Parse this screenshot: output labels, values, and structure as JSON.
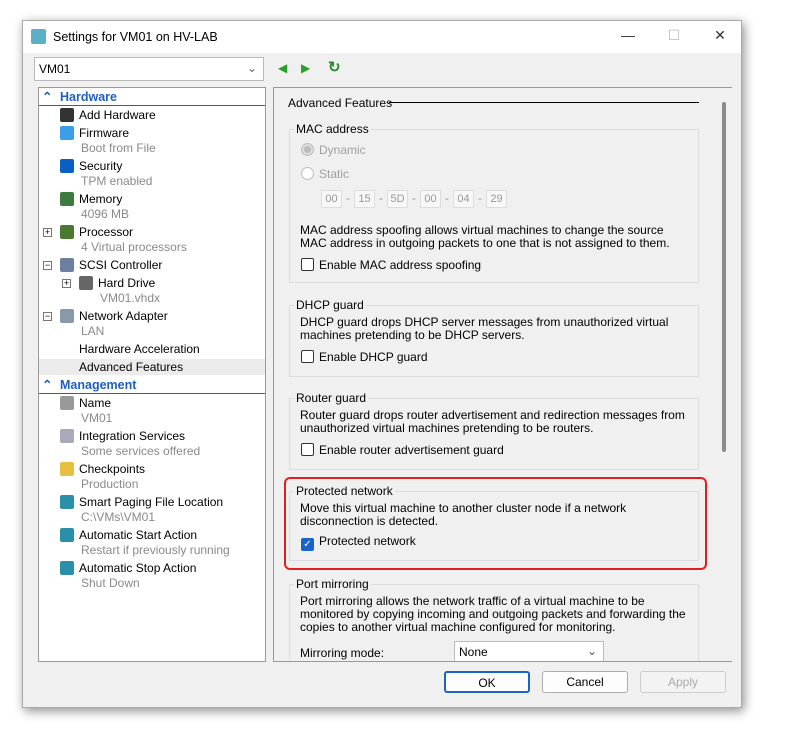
{
  "window": {
    "title": "Settings for VM01 on HV-LAB",
    "vm_selector": "VM01"
  },
  "toolbar": {
    "back": "◀",
    "forward": "▶",
    "refresh": "↻"
  },
  "tree": [
    {
      "type": "header",
      "label": "Hardware"
    },
    {
      "label": "Add Hardware",
      "icon": "add-hardware-icon",
      "color": "#333"
    },
    {
      "label": "Firmware",
      "sub": "Boot from File",
      "icon": "firmware-icon",
      "color": "#3a9ee8"
    },
    {
      "label": "Security",
      "sub": "TPM enabled",
      "icon": "shield-icon",
      "color": "#0a5fc4"
    },
    {
      "label": "Memory",
      "sub": "4096 MB",
      "icon": "memory-icon",
      "color": "#3d7a3d"
    },
    {
      "label": "Processor",
      "sub": "4 Virtual processors",
      "icon": "processor-icon",
      "color": "#4a7a30",
      "exp": "+"
    },
    {
      "label": "SCSI Controller",
      "icon": "scsi-controller-icon",
      "color": "#6d7fa0",
      "exp": "−"
    },
    {
      "label": "Hard Drive",
      "sub": "VM01.vhdx",
      "icon": "hard-drive-icon",
      "color": "#666",
      "exp": "+",
      "indent": 1
    },
    {
      "label": "Network Adapter",
      "sub": "LAN",
      "icon": "network-adapter-icon",
      "color": "#8899aa",
      "exp": "−"
    },
    {
      "label": "Hardware Acceleration",
      "indent": 0,
      "noicon": true
    },
    {
      "label": "Advanced Features",
      "selected": true,
      "noicon": true
    },
    {
      "type": "header",
      "label": "Management"
    },
    {
      "label": "Name",
      "sub": "VM01",
      "icon": "name-icon",
      "color": "#999"
    },
    {
      "label": "Integration Services",
      "sub": "Some services offered",
      "icon": "integration-services-icon",
      "color": "#aab"
    },
    {
      "label": "Checkpoints",
      "sub": "Production",
      "icon": "checkpoints-icon",
      "color": "#e8c040"
    },
    {
      "label": "Smart Paging File Location",
      "sub": "C:\\VMs\\VM01",
      "icon": "smart-paging-icon",
      "color": "#2a8fa8"
    },
    {
      "label": "Automatic Start Action",
      "sub": "Restart if previously running",
      "icon": "auto-start-icon",
      "color": "#2a8fa8"
    },
    {
      "label": "Automatic Stop Action",
      "sub": "Shut Down",
      "icon": "auto-stop-icon",
      "color": "#2a8fa8"
    }
  ],
  "panel": {
    "title": "Advanced Features",
    "mac": {
      "label": "MAC address",
      "dynamic": "Dynamic",
      "static": "Static",
      "octets": [
        "00",
        "15",
        "5D",
        "00",
        "04",
        "29"
      ],
      "desc": "MAC address spoofing allows virtual machines to change the source MAC address in outgoing packets to one that is not assigned to them.",
      "spoof_label": "Enable MAC address spoofing"
    },
    "dhcp": {
      "label": "DHCP guard",
      "desc": "DHCP guard drops DHCP server messages from unauthorized virtual machines pretending to be DHCP servers.",
      "check_label": "Enable DHCP guard"
    },
    "router": {
      "label": "Router guard",
      "desc": "Router guard drops router advertisement and redirection messages from unauthorized virtual machines pretending to be routers.",
      "check_label": "Enable router advertisement guard"
    },
    "protected": {
      "label": "Protected network",
      "desc": "Move this virtual machine to another cluster node if a network disconnection is detected.",
      "check_label": "Protected network",
      "checked": true,
      "highlight_color": "#e02020"
    },
    "mirror": {
      "label": "Port mirroring",
      "desc": "Port mirroring allows the network traffic of a virtual machine to be monitored by copying incoming and outgoing packets and forwarding the copies to another virtual machine configured for monitoring.",
      "mode_label": "Mirroring mode:",
      "mode_value": "None"
    }
  },
  "buttons": {
    "ok": "OK",
    "cancel": "Cancel",
    "apply": "Apply"
  }
}
